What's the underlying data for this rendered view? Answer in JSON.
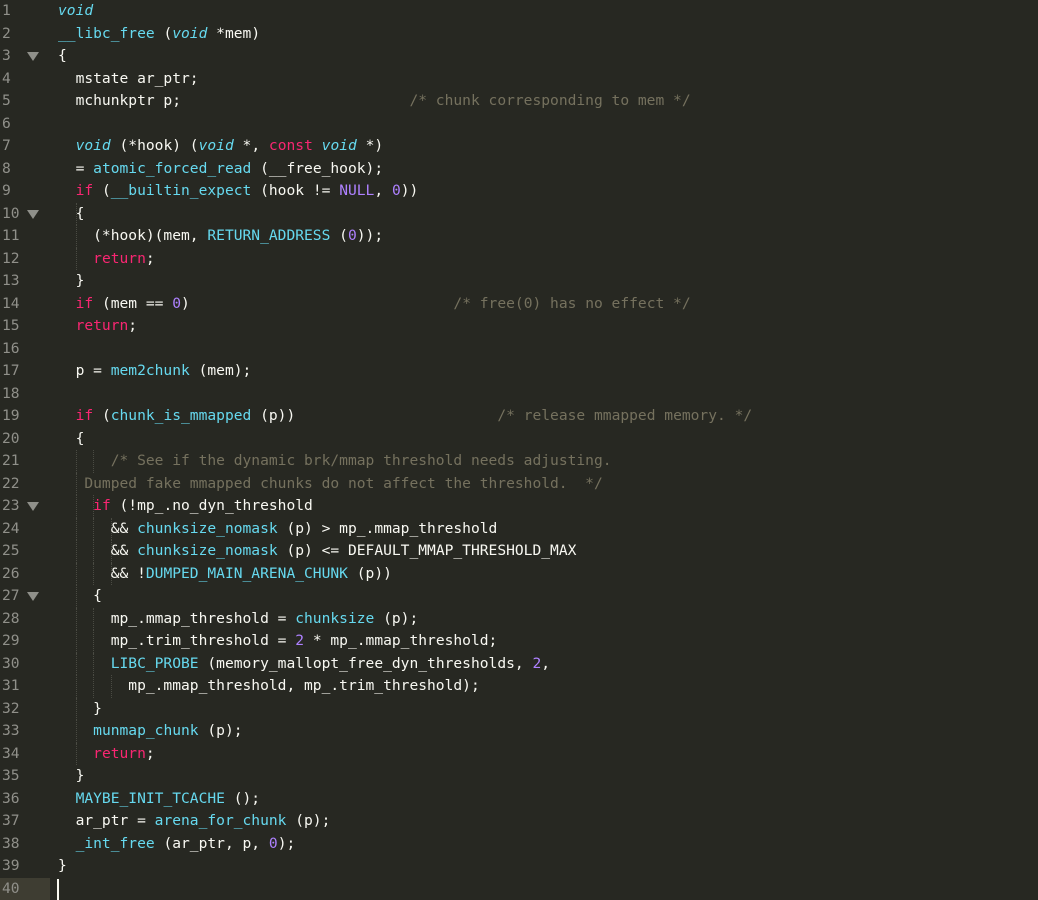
{
  "editor": {
    "current_line": 40,
    "lines": [
      {
        "n": "1",
        "fold": false,
        "tokens": [
          {
            "c": "kt",
            "t": "void"
          }
        ]
      },
      {
        "n": "2",
        "fold": false,
        "tokens": [
          {
            "c": "fn",
            "t": "__libc_free"
          },
          {
            "c": "pl",
            "t": " ("
          },
          {
            "c": "kt",
            "t": "void"
          },
          {
            "c": "pl",
            "t": " *mem)"
          }
        ]
      },
      {
        "n": "3",
        "fold": true,
        "tokens": [
          {
            "c": "pl",
            "t": "{"
          }
        ]
      },
      {
        "n": "4",
        "fold": false,
        "tokens": [
          {
            "c": "pl",
            "t": "  mstate ar_ptr;"
          }
        ]
      },
      {
        "n": "5",
        "fold": false,
        "tokens": [
          {
            "c": "pl",
            "t": "  mchunkptr p;                          "
          },
          {
            "c": "cm",
            "t": "/* chunk corresponding to mem */"
          }
        ]
      },
      {
        "n": "6",
        "fold": false,
        "tokens": []
      },
      {
        "n": "7",
        "fold": false,
        "tokens": [
          {
            "c": "pl",
            "t": "  "
          },
          {
            "c": "kt",
            "t": "void"
          },
          {
            "c": "pl",
            "t": " (*hook) ("
          },
          {
            "c": "kt",
            "t": "void"
          },
          {
            "c": "pl",
            "t": " *, "
          },
          {
            "c": "kw",
            "t": "const"
          },
          {
            "c": "pl",
            "t": " "
          },
          {
            "c": "kt",
            "t": "void"
          },
          {
            "c": "pl",
            "t": " *)"
          }
        ]
      },
      {
        "n": "8",
        "fold": false,
        "tokens": [
          {
            "c": "pl",
            "t": "  = "
          },
          {
            "c": "fn",
            "t": "atomic_forced_read"
          },
          {
            "c": "pl",
            "t": " (__free_hook);"
          }
        ]
      },
      {
        "n": "9",
        "fold": false,
        "tokens": [
          {
            "c": "pl",
            "t": "  "
          },
          {
            "c": "kw",
            "t": "if"
          },
          {
            "c": "pl",
            "t": " ("
          },
          {
            "c": "fn",
            "t": "__builtin_expect"
          },
          {
            "c": "pl",
            "t": " (hook != "
          },
          {
            "c": "num-c",
            "t": "NULL"
          },
          {
            "c": "pl",
            "t": ", "
          },
          {
            "c": "num-c",
            "t": "0"
          },
          {
            "c": "pl",
            "t": "))"
          }
        ]
      },
      {
        "n": "10",
        "fold": true,
        "tokens": [
          {
            "c": "pl",
            "t": "  {"
          }
        ]
      },
      {
        "n": "11",
        "fold": false,
        "tokens": [
          {
            "c": "pl",
            "t": "    (*hook)(mem, "
          },
          {
            "c": "fn",
            "t": "RETURN_ADDRESS"
          },
          {
            "c": "pl",
            "t": " ("
          },
          {
            "c": "num-c",
            "t": "0"
          },
          {
            "c": "pl",
            "t": "));"
          }
        ]
      },
      {
        "n": "12",
        "fold": false,
        "tokens": [
          {
            "c": "pl",
            "t": "    "
          },
          {
            "c": "kw",
            "t": "return"
          },
          {
            "c": "pl",
            "t": ";"
          }
        ]
      },
      {
        "n": "13",
        "fold": false,
        "tokens": [
          {
            "c": "pl",
            "t": "  }"
          }
        ]
      },
      {
        "n": "14",
        "fold": false,
        "tokens": [
          {
            "c": "pl",
            "t": "  "
          },
          {
            "c": "kw",
            "t": "if"
          },
          {
            "c": "pl",
            "t": " (mem == "
          },
          {
            "c": "num-c",
            "t": "0"
          },
          {
            "c": "pl",
            "t": ")                              "
          },
          {
            "c": "cm",
            "t": "/* free(0) has no effect */"
          }
        ]
      },
      {
        "n": "15",
        "fold": false,
        "tokens": [
          {
            "c": "pl",
            "t": "  "
          },
          {
            "c": "kw",
            "t": "return"
          },
          {
            "c": "pl",
            "t": ";"
          }
        ]
      },
      {
        "n": "16",
        "fold": false,
        "tokens": []
      },
      {
        "n": "17",
        "fold": false,
        "tokens": [
          {
            "c": "pl",
            "t": "  p = "
          },
          {
            "c": "fn",
            "t": "mem2chunk"
          },
          {
            "c": "pl",
            "t": " (mem);"
          }
        ]
      },
      {
        "n": "18",
        "fold": false,
        "tokens": []
      },
      {
        "n": "19",
        "fold": false,
        "tokens": [
          {
            "c": "pl",
            "t": "  "
          },
          {
            "c": "kw",
            "t": "if"
          },
          {
            "c": "pl",
            "t": " ("
          },
          {
            "c": "fn",
            "t": "chunk_is_mmapped"
          },
          {
            "c": "pl",
            "t": " (p))                       "
          },
          {
            "c": "cm",
            "t": "/* release mmapped memory. */"
          }
        ]
      },
      {
        "n": "20",
        "fold": false,
        "tokens": [
          {
            "c": "pl",
            "t": "  {"
          }
        ]
      },
      {
        "n": "21",
        "fold": false,
        "tokens": [
          {
            "c": "pl",
            "t": "      "
          },
          {
            "c": "cm",
            "t": "/* See if the dynamic brk/mmap threshold needs adjusting."
          }
        ]
      },
      {
        "n": "22",
        "fold": false,
        "tokens": [
          {
            "c": "cm",
            "t": "   Dumped fake mmapped chunks do not affect the threshold.  */"
          }
        ]
      },
      {
        "n": "23",
        "fold": true,
        "tokens": [
          {
            "c": "pl",
            "t": "    "
          },
          {
            "c": "kw",
            "t": "if"
          },
          {
            "c": "pl",
            "t": " (!mp_.no_dyn_threshold"
          }
        ]
      },
      {
        "n": "24",
        "fold": false,
        "tokens": [
          {
            "c": "pl",
            "t": "      && "
          },
          {
            "c": "fn",
            "t": "chunksize_nomask"
          },
          {
            "c": "pl",
            "t": " (p) > mp_.mmap_threshold"
          }
        ]
      },
      {
        "n": "25",
        "fold": false,
        "tokens": [
          {
            "c": "pl",
            "t": "      && "
          },
          {
            "c": "fn",
            "t": "chunksize_nomask"
          },
          {
            "c": "pl",
            "t": " (p) <= DEFAULT_MMAP_THRESHOLD_MAX"
          }
        ]
      },
      {
        "n": "26",
        "fold": false,
        "tokens": [
          {
            "c": "pl",
            "t": "      && !"
          },
          {
            "c": "fn",
            "t": "DUMPED_MAIN_ARENA_CHUNK"
          },
          {
            "c": "pl",
            "t": " (p))"
          }
        ]
      },
      {
        "n": "27",
        "fold": true,
        "tokens": [
          {
            "c": "pl",
            "t": "    {"
          }
        ]
      },
      {
        "n": "28",
        "fold": false,
        "tokens": [
          {
            "c": "pl",
            "t": "      mp_.mmap_threshold = "
          },
          {
            "c": "fn",
            "t": "chunksize"
          },
          {
            "c": "pl",
            "t": " (p);"
          }
        ]
      },
      {
        "n": "29",
        "fold": false,
        "tokens": [
          {
            "c": "pl",
            "t": "      mp_.trim_threshold = "
          },
          {
            "c": "num-c",
            "t": "2"
          },
          {
            "c": "pl",
            "t": " * mp_.mmap_threshold;"
          }
        ]
      },
      {
        "n": "30",
        "fold": false,
        "tokens": [
          {
            "c": "pl",
            "t": "      "
          },
          {
            "c": "fn",
            "t": "LIBC_PROBE"
          },
          {
            "c": "pl",
            "t": " (memory_mallopt_free_dyn_thresholds, "
          },
          {
            "c": "num-c",
            "t": "2"
          },
          {
            "c": "pl",
            "t": ","
          }
        ]
      },
      {
        "n": "31",
        "fold": false,
        "tokens": [
          {
            "c": "pl",
            "t": "        mp_.mmap_threshold, mp_.trim_threshold);"
          }
        ]
      },
      {
        "n": "32",
        "fold": false,
        "tokens": [
          {
            "c": "pl",
            "t": "    }"
          }
        ]
      },
      {
        "n": "33",
        "fold": false,
        "tokens": [
          {
            "c": "pl",
            "t": "    "
          },
          {
            "c": "fn",
            "t": "munmap_chunk"
          },
          {
            "c": "pl",
            "t": " (p);"
          }
        ]
      },
      {
        "n": "34",
        "fold": false,
        "tokens": [
          {
            "c": "pl",
            "t": "    "
          },
          {
            "c": "kw",
            "t": "return"
          },
          {
            "c": "pl",
            "t": ";"
          }
        ]
      },
      {
        "n": "35",
        "fold": false,
        "tokens": [
          {
            "c": "pl",
            "t": "  }"
          }
        ]
      },
      {
        "n": "36",
        "fold": false,
        "tokens": [
          {
            "c": "pl",
            "t": "  "
          },
          {
            "c": "fn",
            "t": "MAYBE_INIT_TCACHE"
          },
          {
            "c": "pl",
            "t": " ();"
          }
        ]
      },
      {
        "n": "37",
        "fold": false,
        "tokens": [
          {
            "c": "pl",
            "t": "  ar_ptr = "
          },
          {
            "c": "fn",
            "t": "arena_for_chunk"
          },
          {
            "c": "pl",
            "t": " (p);"
          }
        ]
      },
      {
        "n": "38",
        "fold": false,
        "tokens": [
          {
            "c": "pl",
            "t": "  "
          },
          {
            "c": "fn",
            "t": "_int_free"
          },
          {
            "c": "pl",
            "t": " (ar_ptr, p, "
          },
          {
            "c": "num-c",
            "t": "0"
          },
          {
            "c": "pl",
            "t": ");"
          }
        ]
      },
      {
        "n": "39",
        "fold": false,
        "tokens": [
          {
            "c": "pl",
            "t": "}"
          }
        ]
      },
      {
        "n": "40",
        "fold": false,
        "tokens": []
      }
    ]
  }
}
